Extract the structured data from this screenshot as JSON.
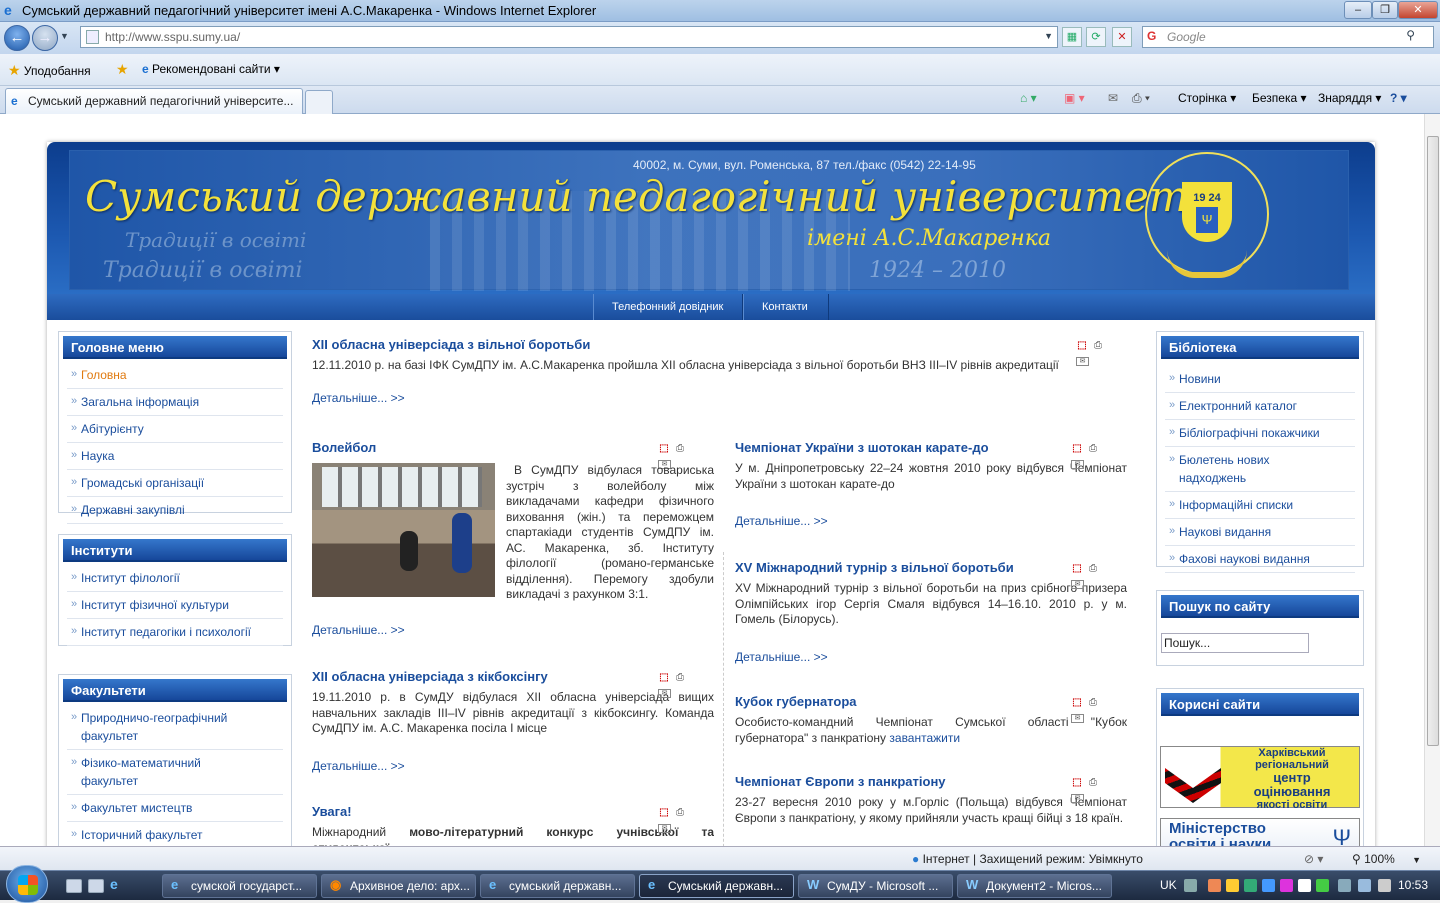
{
  "window": {
    "title": "Сумський державний педагогічний університет імені А.С.Макаренка - Windows Internet Explorer"
  },
  "address": {
    "url": "http://www.sspu.sumy.ua/",
    "search_placeholder": "Google"
  },
  "favorites": {
    "favorites_label": "Уподобання",
    "suggested_label": "Рекомендовані сайти ▾"
  },
  "tabs": {
    "active_label": "Сумський державний педагогічний університе..."
  },
  "commands": {
    "page": "Сторінка ▾",
    "safety": "Безпека ▾",
    "tools": "Знаряддя ▾"
  },
  "site": {
    "address_line": "40002, м. Суми, вул. Роменська, 87 тел./факс (0542) 22-14-95",
    "title": "Сумський державний педагогічний університет",
    "subtitle": "імені А.С.Макаренка",
    "years": "1924 – 2010",
    "tradition": "Традиції в освіті",
    "emblem_year": "19 24",
    "nav": [
      "Телефонний довідник",
      "Контакти"
    ]
  },
  "left": {
    "main_menu": {
      "title": "Головне меню",
      "items": [
        "Головна",
        "Загальна інформація",
        "Абітурієнту",
        "Наука",
        "Громадські організації",
        "Державні закупівлі"
      ]
    },
    "institutes": {
      "title": "Інститути",
      "items": [
        "Інститут філології",
        "Інститут фізичної культури",
        "Інститут педагогіки і психології"
      ]
    },
    "faculties": {
      "title": "Факультети",
      "items": [
        "Природничо-географічний факультет",
        "Фізико-математичний факультет",
        "Факультет мистецтв",
        "Історичний факультет"
      ]
    }
  },
  "articles": {
    "more": "Детальніше...  >>",
    "a1": {
      "title": "XII обласна універсіада з вільної боротьби",
      "text": "12.11.2010 р. на базі ІФК СумДПУ ім. А.С.Макаренка пройшла XII обласна універсіада з вільної боротьби  ВНЗ ІІІ–ІV рівнів акредитації"
    },
    "a2": {
      "title": "Волейбол",
      "text": "В СумДПУ відбулася товариська зустріч з волейболу між викладачами кафедри фізичного виховання (жін.) та переможцем спартакіади студентів СумДПУ ім. АС. Макаренка, зб. Інституту філології (романо-германське відділення). Перемогу здобули викладачі з рахунком 3:1."
    },
    "a3": {
      "title": "Чемпіонат України з шотокан карате-до",
      "text": "У м. Дніпропетровську 22–24 жовтня 2010 року відбувся Чемпіонат України з шотокан карате-до"
    },
    "a4": {
      "title": "XV Міжнародний турнір з вільної боротьби",
      "text": "XV Міжнародний турнір з вільної боротьби на приз срібного призера Олімпійських ігор Сергія Смаля відбувся 14–16.10. 2010 р. у м. Гомель (Білорусь)."
    },
    "a5": {
      "title": "XII обласна універсіада з кікбоксінгу",
      "text": "19.11.2010 р. в СумДУ відбулася XII обласна універсіада вищих навчальних закладів ІІІ–ІV рівнів акредитації з кікбоксингу. Команда СумДПУ ім. А.С. Макаренка посіла І місце"
    },
    "a6": {
      "title": "Кубок губернатора",
      "text": "Особисто-командний Чемпіонат Сумської області \"Кубок губернатора\" з панкратіону",
      "link": "завантажити"
    },
    "a7": {
      "title": "Увага!",
      "text_pre": "Міжнародний ",
      "text_bold": "мово-літературний конкурс учнівської та студентської"
    },
    "a8": {
      "title": "Чемпіонат Європи з панкратіону",
      "text": "23-27 вересня 2010 року у м.Горліс (Польща) відбувся Чемпіонат Європи з панкратіону, у якому прийняли участь кращі бійці з 18 країн."
    }
  },
  "right": {
    "library": {
      "title": "Бібліотека",
      "items": [
        "Новини",
        "Електронний каталог",
        "Бібліографічні покажчики",
        "Бюлетень нових надходжень",
        "Інформаційні списки",
        "Наукові видання",
        "Фахові наукові видання"
      ]
    },
    "search": {
      "title": "Пошук по сайту",
      "placeholder": "Пошук..."
    },
    "useful": {
      "title": "Корисні сайти",
      "banner1_line1": "Харківський",
      "banner1_line2": "регіональний",
      "banner1_line3": "центр",
      "banner1_line4": "оцінювання",
      "banner1_line5": "якості освіти",
      "banner2_line1": "Міністерство",
      "banner2_line2": "освіти і науки"
    }
  },
  "status": {
    "zone": "Інтернет | Захищений режим: Увімкнуто",
    "zoom": "100%"
  },
  "taskbar": {
    "items": [
      "сумской государст...",
      "Архивное дело: арх...",
      "сумський державн...",
      "Сумський державн...",
      "СумДУ - Microsoft ...",
      "Документ2 - Micros..."
    ],
    "lang": "UK",
    "clock": "10:53"
  }
}
